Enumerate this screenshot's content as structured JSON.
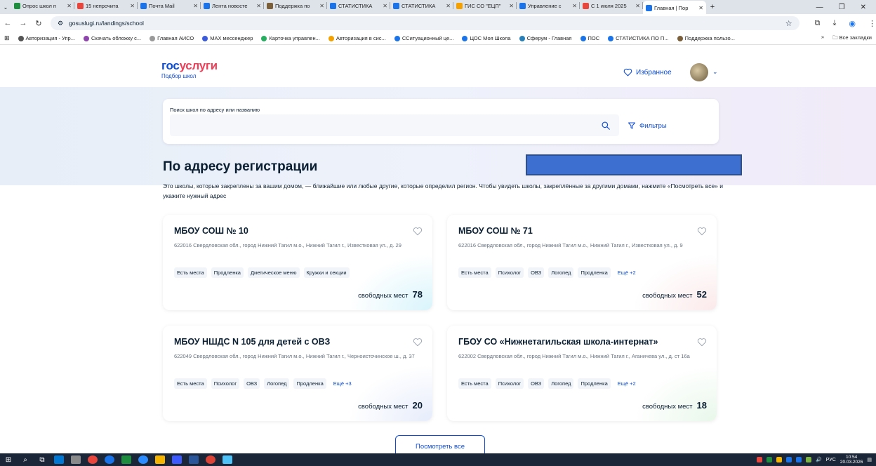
{
  "browser": {
    "tabs": [
      {
        "title": "Опрос школ п",
        "color": "#1e8e3e"
      },
      {
        "title": "15 непрочита",
        "color": "#e8453c"
      },
      {
        "title": "Почта Mail",
        "color": "#1a73e8"
      },
      {
        "title": "Лента новосте",
        "color": "#1a73e8"
      },
      {
        "title": "Поддержка по",
        "color": "#7b5e3a"
      },
      {
        "title": "СТАТИСТИКА",
        "color": "#1a73e8"
      },
      {
        "title": "СТАТИСТИКА",
        "color": "#1a73e8"
      },
      {
        "title": "ГИС СО \"ЕЦП\"",
        "color": "#f4a100"
      },
      {
        "title": "Управление с",
        "color": "#1a73e8"
      },
      {
        "title": "С 1 июля 2025",
        "color": "#e8453c"
      },
      {
        "title": "Главная | Пор",
        "color": "#1a73e8",
        "active": true
      }
    ],
    "url": "gosuslugi.ru/landings/school",
    "bookmarks": [
      {
        "label": "Авторизация - Упр...",
        "color": "#555555"
      },
      {
        "label": "Скачать обложку с...",
        "color": "#8e44ad"
      },
      {
        "label": "Главная АИСО",
        "color": "#999999"
      },
      {
        "label": "MAX мессенджер",
        "color": "#3b5bdb"
      },
      {
        "label": "Карточка управлен...",
        "color": "#27ae60"
      },
      {
        "label": "Авторизация в сис...",
        "color": "#f4a100"
      },
      {
        "label": "ССитуационный це...",
        "color": "#1a73e8"
      },
      {
        "label": "ЦОС Моя Школа",
        "color": "#1a73e8"
      },
      {
        "label": "Сферум - Главная",
        "color": "#2980b9"
      },
      {
        "label": "ПОС",
        "color": "#1a73e8"
      },
      {
        "label": "СТАТИСТИКА ПО П...",
        "color": "#1a73e8"
      },
      {
        "label": "Поддержка пользо...",
        "color": "#7b5e3a"
      }
    ],
    "all_bookmarks": "Все закладки"
  },
  "header": {
    "logo_a": "гос",
    "logo_b": "услуги",
    "logo_sub": "Подбор школ",
    "favorites": "Избранное"
  },
  "search": {
    "label": "Поиск школ по адресу или названию",
    "placeholder": "",
    "filters": "Фильтры"
  },
  "section": {
    "title": "По адресу регистрации",
    "description": "Это школы, которые закреплены за вашим домом, — ближайшие или любые другие, которые определил регион. Чтобы увидеть школы, закреплённые за другими домами, нажмите «Посмотреть все» и укажите нужный адрес"
  },
  "cards": [
    {
      "name": "МБОУ СОШ № 10",
      "address": "622016 Свердловская обл., город Нижний Тагил м.о., Нижний Тагил г., Известковая ул., д. 29",
      "tags": [
        "Есть места",
        "Продленка",
        "Диетическое меню",
        "Кружки и секции"
      ],
      "more": "",
      "free_label": "свободных мест",
      "free_count": "78",
      "glow": "#d8f4fb"
    },
    {
      "name": "МБОУ СОШ № 71",
      "address": "622016 Свердловская обл., город Нижний Тагил м.о., Нижний Тагил г., Известковая ул., д. 9",
      "tags": [
        "Есть места",
        "Психолог",
        "ОВЗ",
        "Логопед",
        "Продленка"
      ],
      "more": "Ещё +2",
      "free_label": "свободных мест",
      "free_count": "52",
      "glow": "#fbe9ea"
    },
    {
      "name": "МБОУ НШДС N 105 для детей с ОВЗ",
      "address": "622049 Свердловская обл., город Нижний Тагил м.о., Нижний Тагил г., Черноисточинское ш., д. 37",
      "tags": [
        "Есть места",
        "Психолог",
        "ОВЗ",
        "Логопед",
        "Продленка"
      ],
      "more": "Ещё +3",
      "free_label": "свободных мест",
      "free_count": "20",
      "glow": "#e6ecfb"
    },
    {
      "name": "ГБОУ СО «Нижнетагильская школа-интернат»",
      "address": "622002 Свердловская обл., город Нижний Тагил м.о., Нижний Тагил г., Аганичева ул., д. ст 16а",
      "tags": [
        "Есть места",
        "Психолог",
        "ОВЗ",
        "Логопед",
        "Продленка"
      ],
      "more": "Ещё +2",
      "free_label": "свободных мест",
      "free_count": "18",
      "glow": "#e8f7ea"
    }
  ],
  "view_all": "Посмотреть все",
  "taskbar": {
    "lang": "РУС",
    "time": "10:54",
    "date": "20.03.2026"
  },
  "colors": {
    "brand_blue": "#0d4cd3",
    "brand_red": "#ee3f58"
  }
}
